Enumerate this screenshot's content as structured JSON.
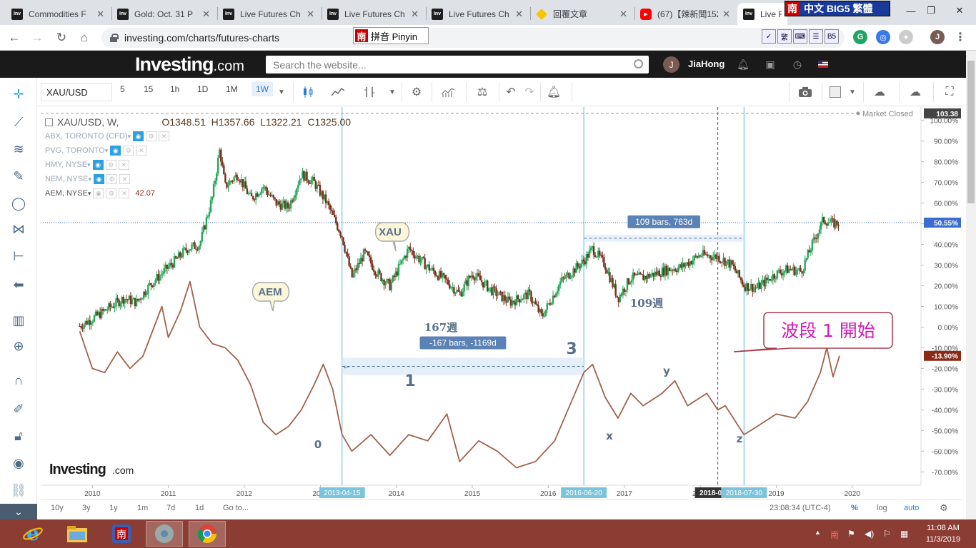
{
  "browser": {
    "tabs": [
      {
        "title": "Commodities F",
        "icon": "investing-favicon",
        "active": false
      },
      {
        "title": "Gold: Oct. 31 P",
        "icon": "investing-favicon",
        "active": false
      },
      {
        "title": "Live Futures Ch",
        "icon": "investing-favicon",
        "active": false
      },
      {
        "title": "Live Futures Ch",
        "icon": "investing-favicon",
        "active": false
      },
      {
        "title": "Live Futures Ch",
        "icon": "investing-favicon",
        "active": false
      },
      {
        "title": "回覆文章",
        "icon": "diamond-favicon",
        "active": false
      },
      {
        "title": "(67)【辣新聞152",
        "icon": "youtube-favicon",
        "active": false
      },
      {
        "title": "Live Fu",
        "icon": "investing-favicon",
        "active": true
      }
    ],
    "url": "investing.com/charts/futures-charts",
    "ime_input": {
      "badge": "南",
      "label": "拼音 Pinyin"
    },
    "ime_mode": {
      "badge": "南",
      "label": "中文 BIG5 繁體"
    },
    "ime_icons": [
      "✓",
      "繁",
      "⌨",
      "☰",
      "B5"
    ],
    "profile_initial": "J"
  },
  "site": {
    "logo_main": "Investing",
    "logo_suffix": ".com",
    "search_placeholder": "Search the website...",
    "user_initial": "J",
    "user_name": "JiaHong"
  },
  "toolbar": {
    "symbol": "XAU/USD",
    "timeframes": [
      "5",
      "15",
      "1h",
      "1D",
      "1M",
      "1W"
    ],
    "selected_timeframe": "1W"
  },
  "legend": {
    "title": "XAU/USD, W,",
    "open": "O1348.51",
    "high": "H1357.66",
    "low": "L1322.21",
    "close": "C1325.00",
    "studies": [
      {
        "name": "ABX, TORONTO (CFD)",
        "value": ""
      },
      {
        "name": "PVG, TORONTO",
        "value": ""
      },
      {
        "name": "HMY, NYSE",
        "value": ""
      },
      {
        "name": "NEM, NYSE",
        "value": ""
      },
      {
        "name": "AEM, NYSE",
        "value": "42.07"
      }
    ]
  },
  "chart_data": {
    "type": "line",
    "market_status": "Market Closed",
    "y_axis": {
      "unit": "%",
      "ticks": [
        "100.00%",
        "90.00%",
        "80.00%",
        "70.00%",
        "60.00%",
        "50.00%",
        "40.00%",
        "30.00%",
        "20.00%",
        "10.00%",
        "0.00%",
        "-10.00%",
        "-20.00%",
        "-30.00%",
        "-40.00%",
        "-50.00%",
        "-60.00%",
        "-70.00%"
      ],
      "range": [
        -73,
        103
      ]
    },
    "x_axis": {
      "ticks": [
        "2010",
        "2011",
        "2012",
        "2013",
        "2014",
        "2015",
        "2016",
        "2017",
        "2018",
        "2019",
        "2020"
      ]
    },
    "price_labels": [
      {
        "text": "103.38",
        "value": 103.38,
        "color": "#444444"
      },
      {
        "text": "50.55%",
        "value": 50.55,
        "color": "#3a6fd0"
      },
      {
        "text": "-13.90%",
        "value": -13.9,
        "color": "#8a2a14"
      }
    ],
    "series": [
      {
        "name": "XAU/USD",
        "style": "candles",
        "color_up": "#26a65b",
        "color_down": "#7a2e1a",
        "points": [
          [
            "2009-11-01",
            0.5
          ],
          [
            "2010-02-01",
            6
          ],
          [
            "2010-04-01",
            10
          ],
          [
            "2010-06-01",
            14
          ],
          [
            "2010-08-01",
            12
          ],
          [
            "2010-10-01",
            20
          ],
          [
            "2010-12-01",
            26
          ],
          [
            "2011-02-01",
            32
          ],
          [
            "2011-04-01",
            38
          ],
          [
            "2011-06-01",
            40
          ],
          [
            "2011-08-01",
            63
          ],
          [
            "2011-09-05",
            86
          ],
          [
            "2011-10-01",
            68
          ],
          [
            "2011-12-01",
            74
          ],
          [
            "2012-02-01",
            62
          ],
          [
            "2012-04-01",
            68
          ],
          [
            "2012-06-01",
            60
          ],
          [
            "2012-08-01",
            58
          ],
          [
            "2012-10-01",
            74
          ],
          [
            "2012-12-01",
            70
          ],
          [
            "2013-02-01",
            60
          ],
          [
            "2013-04-15",
            44
          ],
          [
            "2013-06-01",
            24
          ],
          [
            "2013-08-01",
            36
          ],
          [
            "2013-10-01",
            26
          ],
          [
            "2013-12-01",
            20
          ],
          [
            "2014-03-01",
            38
          ],
          [
            "2014-06-01",
            29
          ],
          [
            "2014-09-01",
            22
          ],
          [
            "2014-11-01",
            16
          ],
          [
            "2015-01-01",
            26
          ],
          [
            "2015-04-01",
            18
          ],
          [
            "2015-07-01",
            12
          ],
          [
            "2015-10-01",
            16
          ],
          [
            "2015-12-01",
            5
          ],
          [
            "2016-03-01",
            22
          ],
          [
            "2016-06-20",
            32
          ],
          [
            "2016-08-01",
            38
          ],
          [
            "2016-10-01",
            30
          ],
          [
            "2016-12-01",
            14
          ],
          [
            "2017-02-01",
            24
          ],
          [
            "2017-04-01",
            24
          ],
          [
            "2017-06-01",
            26
          ],
          [
            "2017-08-01",
            28
          ],
          [
            "2017-10-01",
            29
          ],
          [
            "2018-01-01",
            35
          ],
          [
            "2018-03-26",
            34
          ],
          [
            "2018-06-01",
            30
          ],
          [
            "2018-08-01",
            20
          ],
          [
            "2018-10-01",
            19
          ],
          [
            "2019-01-01",
            26
          ],
          [
            "2019-03-01",
            28
          ],
          [
            "2019-05-01",
            27
          ],
          [
            "2019-06-15",
            38
          ],
          [
            "2019-07-15",
            45
          ],
          [
            "2019-08-15",
            52
          ],
          [
            "2019-10-01",
            50
          ],
          [
            "2019-11-01",
            50.55
          ]
        ]
      },
      {
        "name": "AEM, NYSE",
        "style": "line",
        "color": "#a0624a",
        "points": [
          [
            "2009-11-01",
            -2
          ],
          [
            "2010-01-01",
            -20
          ],
          [
            "2010-03-01",
            -22
          ],
          [
            "2010-05-01",
            -12
          ],
          [
            "2010-07-01",
            -20
          ],
          [
            "2010-09-01",
            -14
          ],
          [
            "2010-12-01",
            10
          ],
          [
            "2011-01-01",
            -5
          ],
          [
            "2011-03-01",
            8
          ],
          [
            "2011-04-15",
            22
          ],
          [
            "2011-06-01",
            0
          ],
          [
            "2011-08-01",
            -8
          ],
          [
            "2011-10-01",
            -10
          ],
          [
            "2011-12-01",
            -16
          ],
          [
            "2012-02-01",
            -28
          ],
          [
            "2012-04-01",
            -46
          ],
          [
            "2012-06-01",
            -52
          ],
          [
            "2012-08-01",
            -48
          ],
          [
            "2012-10-01",
            -40
          ],
          [
            "2012-12-01",
            -28
          ],
          [
            "2013-01-15",
            -18
          ],
          [
            "2013-03-01",
            -30
          ],
          [
            "2013-04-15",
            -52
          ],
          [
            "2013-06-01",
            -60
          ],
          [
            "2013-09-01",
            -52
          ],
          [
            "2013-12-01",
            -62
          ],
          [
            "2014-03-01",
            -52
          ],
          [
            "2014-06-01",
            -55
          ],
          [
            "2014-09-01",
            -42
          ],
          [
            "2014-11-01",
            -65
          ],
          [
            "2015-02-01",
            -55
          ],
          [
            "2015-05-01",
            -60
          ],
          [
            "2015-08-01",
            -68
          ],
          [
            "2015-11-01",
            -65
          ],
          [
            "2016-02-01",
            -55
          ],
          [
            "2016-06-20",
            -22
          ],
          [
            "2016-08-01",
            -18
          ],
          [
            "2016-10-01",
            -34
          ],
          [
            "2016-12-01",
            -44
          ],
          [
            "2017-02-01",
            -32
          ],
          [
            "2017-04-01",
            -38
          ],
          [
            "2017-07-01",
            -32
          ],
          [
            "2017-09-01",
            -26
          ],
          [
            "2017-11-01",
            -38
          ],
          [
            "2018-02-01",
            -32
          ],
          [
            "2018-03-26",
            -40
          ],
          [
            "2018-05-01",
            -38
          ],
          [
            "2018-07-30",
            -52
          ],
          [
            "2018-10-01",
            -48
          ],
          [
            "2019-01-01",
            -42
          ],
          [
            "2019-04-01",
            -44
          ],
          [
            "2019-06-01",
            -36
          ],
          [
            "2019-08-01",
            -22
          ],
          [
            "2019-09-01",
            -10
          ],
          [
            "2019-10-01",
            -24
          ],
          [
            "2019-11-01",
            -13.9
          ]
        ]
      }
    ],
    "annotations": {
      "measure_1": {
        "label": "109 bars, 763d",
        "from": "2016-06-20",
        "to": "2018-07-30",
        "value": 43
      },
      "measure_2": {
        "label": "-167 bars, -1169d",
        "from": "2013-04-15",
        "to": "2016-06-20",
        "value": -19
      },
      "weeks_167": "167週",
      "weeks_109": "109週",
      "bubble_xau": "XAU",
      "bubble_aem": "AEM",
      "callout": "波段 1 開始",
      "wave_labels": [
        "0",
        "1",
        "3",
        "x",
        "y",
        "z"
      ]
    },
    "date_flags": [
      "2013-04-15",
      "2016-06-20",
      "2018-03-26",
      "2018-07-30"
    ],
    "hline_value": 50.55
  },
  "bottom_bar": {
    "ranges": [
      "10y",
      "3y",
      "1y",
      "1m",
      "7d",
      "1d"
    ],
    "goto": "Go to...",
    "time": "23:08:34 (UTC-4)",
    "pct": "%",
    "log": "log",
    "auto": "auto"
  },
  "taskbar": {
    "time": "11:08 AM",
    "date": "11/3/2019"
  }
}
